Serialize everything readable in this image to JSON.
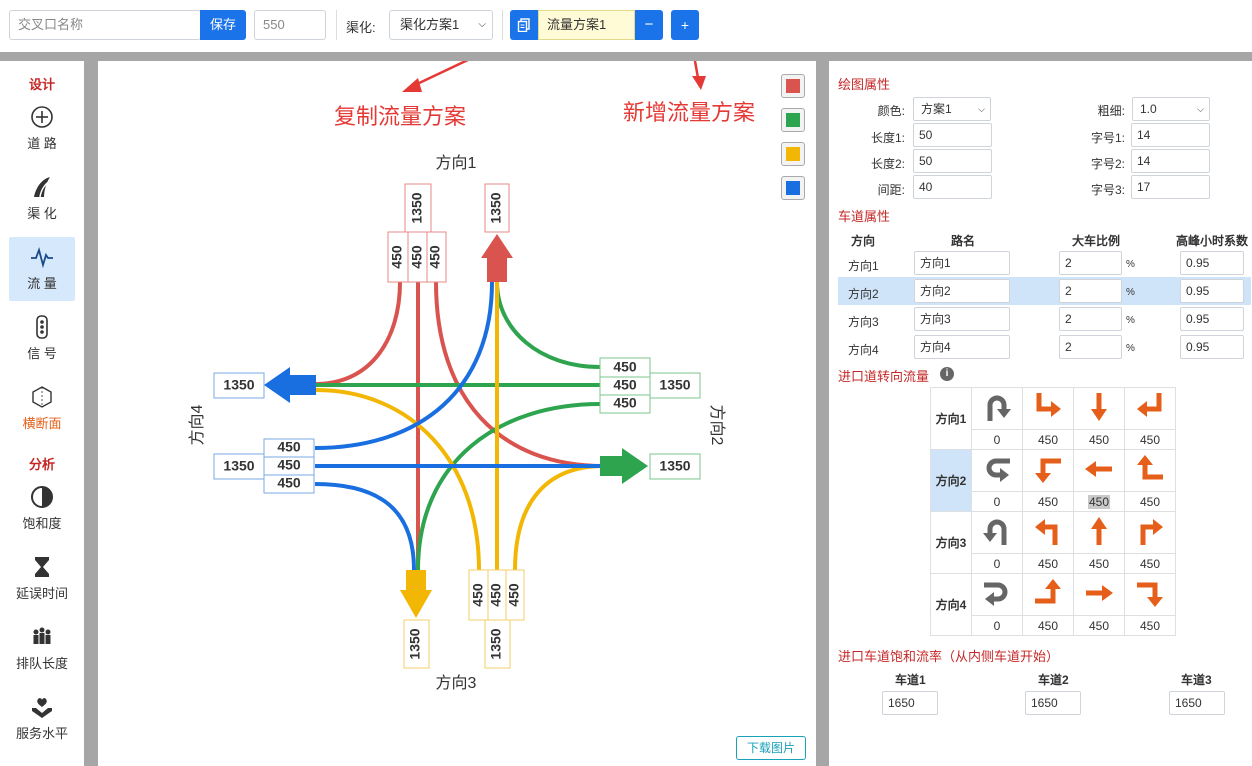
{
  "toolbar": {
    "intersection_name_placeholder": "交叉口名称",
    "save_label": "保存",
    "number_value": "550",
    "channelization_label": "渠化:",
    "channelization_value": "渠化方案1",
    "flow_plan_value": "流量方案1",
    "remove_label": "−",
    "add_label": "+"
  },
  "sidebar": {
    "sections": [
      {
        "label": "设计"
      },
      {
        "label": "分析"
      }
    ],
    "items": [
      {
        "label": "道 路",
        "icon": "crosshair-icon"
      },
      {
        "label": "渠 化",
        "icon": "channelization-icon"
      },
      {
        "label": "流 量",
        "icon": "flow-pulse-icon",
        "active": true
      },
      {
        "label": "信 号",
        "icon": "traffic-light-icon"
      },
      {
        "label": "横断面",
        "icon": "cross-section-icon"
      },
      {
        "label": "饱和度",
        "icon": "half-circle-icon"
      },
      {
        "label": "延误时间",
        "icon": "hourglass-icon"
      },
      {
        "label": "排队长度",
        "icon": "people-queue-icon"
      },
      {
        "label": "服务水平",
        "icon": "heart-hand-icon"
      }
    ]
  },
  "annotations": {
    "copy_flow": "复制流量方案",
    "add_flow": "新增流量方案"
  },
  "diagram": {
    "dir1": "方向1",
    "dir2": "方向2",
    "dir3": "方向3",
    "dir4": "方向4",
    "exit_total": "1350",
    "entry_total": "1350",
    "lane_value": "450",
    "colors": {
      "dir1": "#d9534f",
      "dir2": "#2ea44f",
      "dir3": "#f2b705",
      "dir4": "#1a6fe0"
    },
    "download_label": "下载图片"
  },
  "drawing_props": {
    "title": "绘图属性",
    "color_label": "颜色:",
    "color_value": "方案1",
    "thickness_label": "粗细:",
    "thickness_value": "1.0",
    "length1_label": "长度1:",
    "length1_value": "50",
    "length2_label": "长度2:",
    "length2_value": "50",
    "spacing_label": "间距:",
    "spacing_value": "40",
    "font1_label": "字号1:",
    "font1_value": "14",
    "font2_label": "字号2:",
    "font2_value": "14",
    "font3_label": "字号3:",
    "font3_value": "17"
  },
  "lane_props": {
    "title": "车道属性",
    "headers": {
      "direction": "方向",
      "road": "路名",
      "truck": "大车比例",
      "peak": "高峰小时系数"
    },
    "percent": "%",
    "rows": [
      {
        "direction": "方向1",
        "road": "方向1",
        "truck": "2",
        "peak": "0.95"
      },
      {
        "direction": "方向2",
        "road": "方向2",
        "truck": "2",
        "peak": "0.95"
      },
      {
        "direction": "方向3",
        "road": "方向3",
        "truck": "2",
        "peak": "0.95"
      },
      {
        "direction": "方向4",
        "road": "方向4",
        "truck": "2",
        "peak": "0.95"
      }
    ]
  },
  "turn_flow": {
    "title": "进口道转向流量",
    "info_icon": "i",
    "rows": [
      {
        "direction": "方向1",
        "values": [
          "0",
          "450",
          "450",
          "450"
        ]
      },
      {
        "direction": "方向2",
        "values": [
          "0",
          "450",
          "450",
          "450"
        ]
      },
      {
        "direction": "方向3",
        "values": [
          "0",
          "450",
          "450",
          "450"
        ]
      },
      {
        "direction": "方向4",
        "values": [
          "0",
          "450",
          "450",
          "450"
        ]
      }
    ]
  },
  "saturation": {
    "title": "进口车道饱和流率（从内侧车道开始）",
    "lanes": [
      {
        "label": "车道1",
        "value": "1650"
      },
      {
        "label": "车道2",
        "value": "1650"
      },
      {
        "label": "车道3",
        "value": "1650"
      }
    ]
  }
}
